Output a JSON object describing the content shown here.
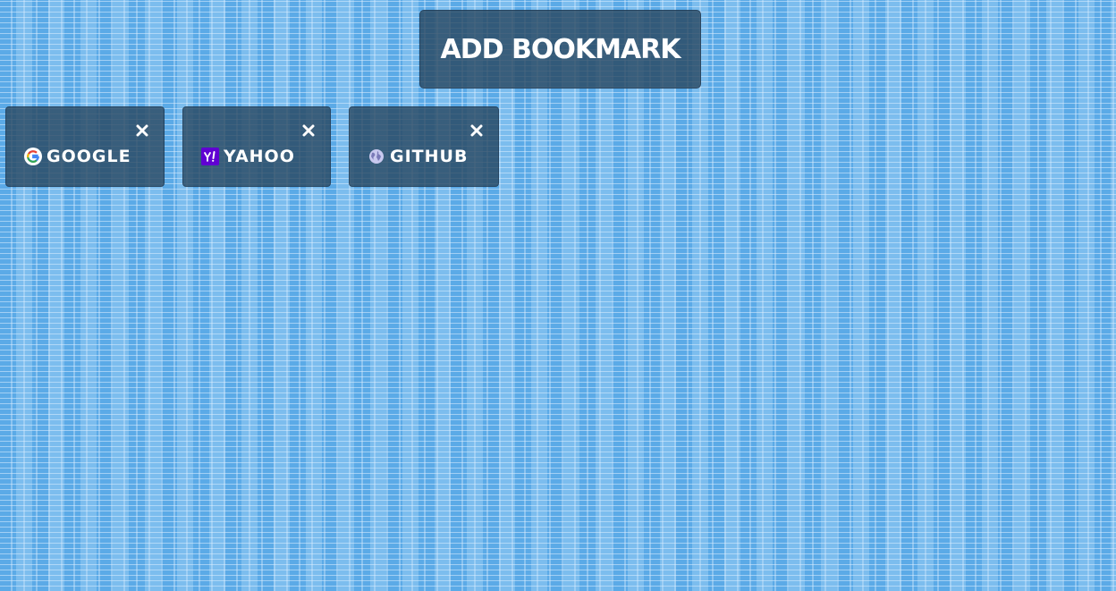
{
  "header": {
    "add_bookmark_label": "ADD BOOKMARK"
  },
  "bookmarks": [
    {
      "name": "GOOGLE",
      "icon": "google-icon",
      "close_icon": "close-icon"
    },
    {
      "name": "YAHOO",
      "icon": "yahoo-icon",
      "close_icon": "close-icon"
    },
    {
      "name": "GITHUB",
      "icon": "globe-icon",
      "close_icon": "close-icon"
    }
  ],
  "colors": {
    "background": "#6cb4ea",
    "card": "#2d4a62",
    "text": "#ffffff",
    "yahoo_purple": "#6001d2"
  }
}
